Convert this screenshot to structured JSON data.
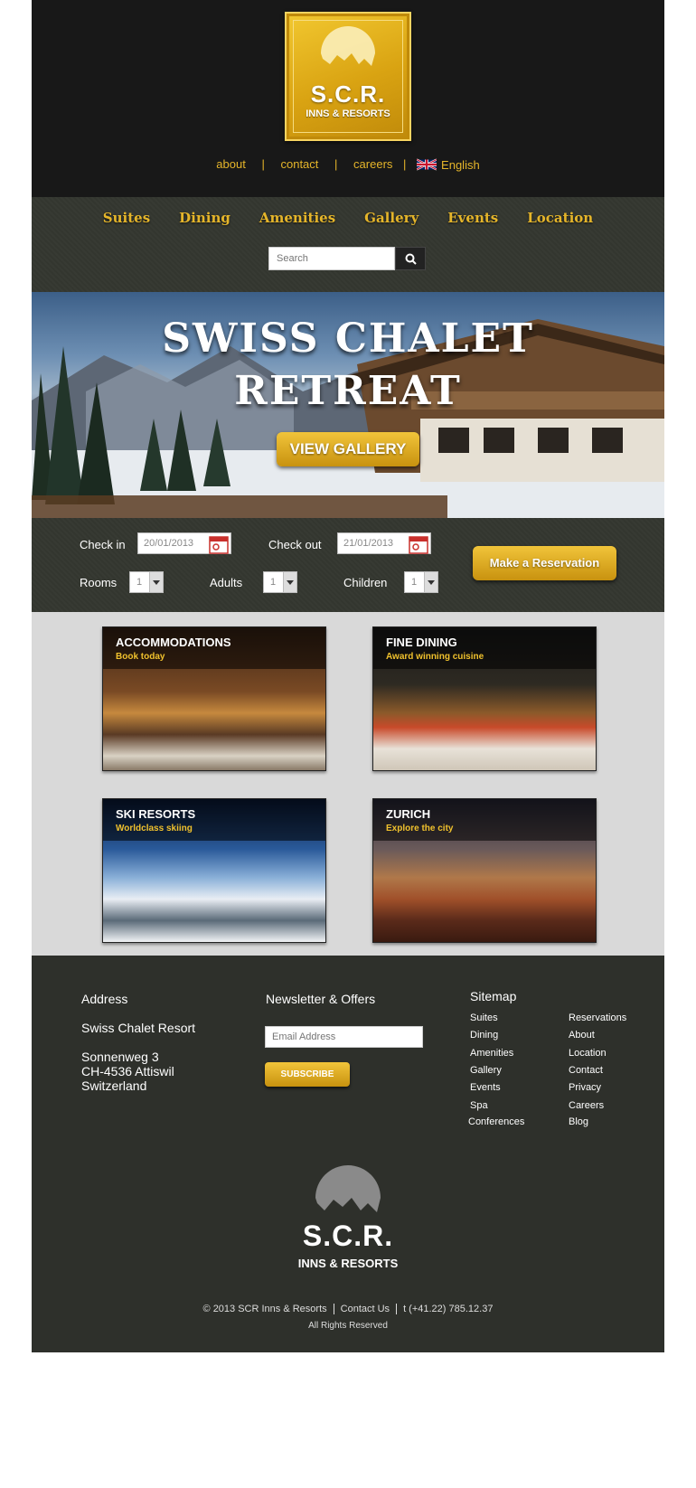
{
  "colors": {
    "accent_gold": "#e5b52a",
    "dark_bg": "#181818",
    "panel_bg": "#33362f",
    "footer_bg": "#2e302b",
    "tiles_bg": "#d9d9d9"
  },
  "logo": {
    "title": "S.C.R.",
    "subtitle": "INNS & RESORTS",
    "icon": "sun-mountain-icon"
  },
  "toplinks": {
    "about": "about",
    "contact": "contact",
    "careers": "careers",
    "separator": "|",
    "language": "English",
    "language_icon": "uk-flag-icon"
  },
  "nav": {
    "items": [
      {
        "label": "Suites"
      },
      {
        "label": "Dining"
      },
      {
        "label": "Amenities"
      },
      {
        "label": "Gallery"
      },
      {
        "label": "Events"
      },
      {
        "label": "Location"
      }
    ]
  },
  "search": {
    "placeholder": "Search",
    "icon": "search-icon"
  },
  "hero": {
    "title_line1": "SWISS CHALET",
    "title_line2": "RETREAT",
    "button_label": "VIEW GALLERY"
  },
  "booking": {
    "checkin_label": "Check in",
    "checkin_value": "20/01/2013",
    "checkout_label": "Check out",
    "checkout_value": "21/01/2013",
    "rooms_label": "Rooms",
    "rooms_value": "1",
    "adults_label": "Adults",
    "adults_value": "1",
    "children_label": "Children",
    "children_value": "1",
    "reserve_label": "Make a Reservation"
  },
  "tiles": [
    {
      "title": "ACCOMMODATIONS",
      "subtitle": "Book today"
    },
    {
      "title": "FINE DINING",
      "subtitle": "Award winning cuisine"
    },
    {
      "title": "SKI RESORTS",
      "subtitle": "Worldclass skiing"
    },
    {
      "title": "ZURICH",
      "subtitle": "Explore the city"
    }
  ],
  "footer": {
    "address_heading": "Address",
    "resort_name": "Swiss Chalet Resort",
    "street": "Sonnenweg 3",
    "city": "CH-4536 Attiswil",
    "country": "Switzerland",
    "newsletter_heading": "Newsletter & Offers",
    "email_placeholder": "Email Address",
    "subscribe_label": "SUBSCRIBE",
    "sitemap_heading": "Sitemap",
    "sitemap_col1": [
      "Suites",
      "Dining",
      "Amenities",
      "Gallery",
      "Events",
      "Spa",
      "Conferences"
    ],
    "sitemap_col2": [
      "Reservations",
      "About",
      "Location",
      "Contact",
      "Privacy",
      "Careers",
      "Blog"
    ],
    "logo_title": "S.C.R.",
    "logo_subtitle": "INNS & RESORTS",
    "copyright": "© 2013 SCR Inns & Resorts",
    "contact_us": "Contact Us",
    "phone": "t (+41.22) 785.12.37",
    "rights": "All Rights Reserved"
  }
}
